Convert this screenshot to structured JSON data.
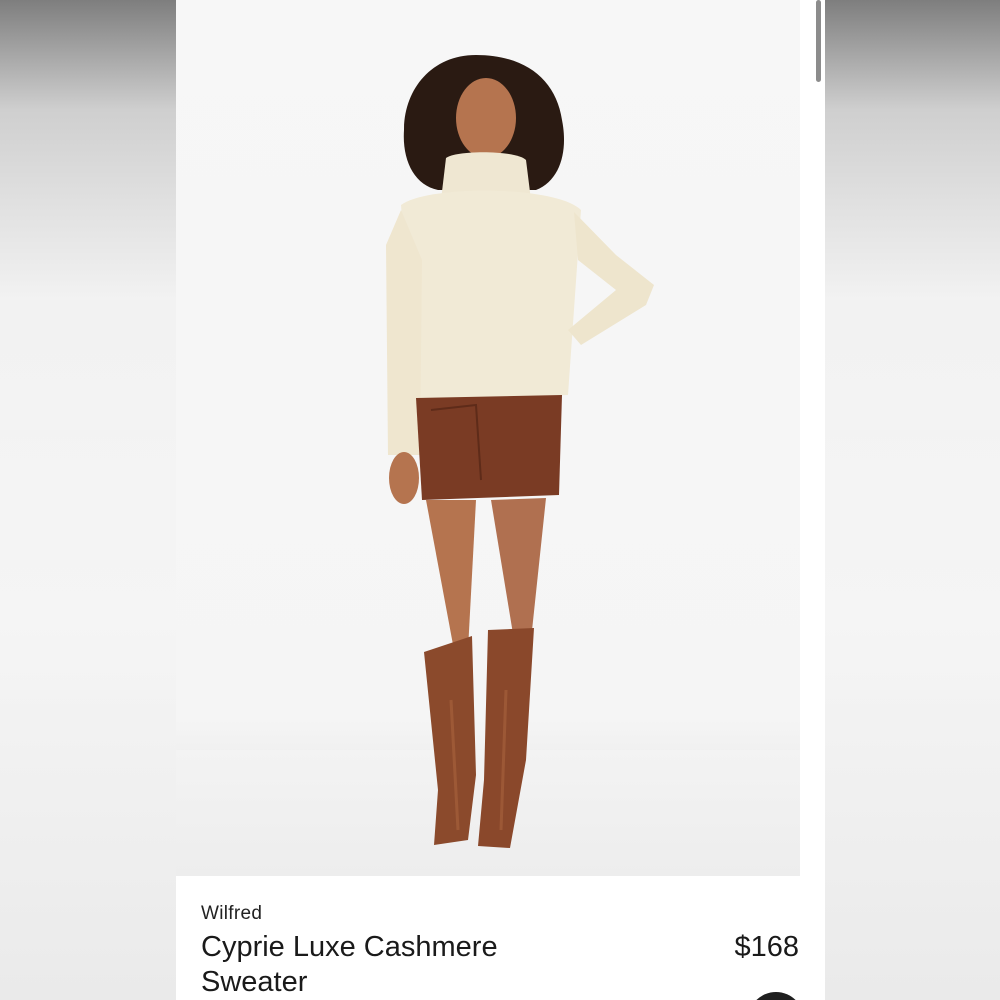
{
  "product": {
    "brand": "Wilfred",
    "name": "Cyprie Luxe Cashmere Sweater",
    "price": "$168",
    "image_alt": "model-wearing-sweater-skirt-boots"
  },
  "colors": {
    "sweater": "#f1ead6",
    "skirt": "#7a3b24",
    "boots": "#8b4a2c",
    "skin": "#b5744f",
    "hair": "#2a1a12"
  }
}
